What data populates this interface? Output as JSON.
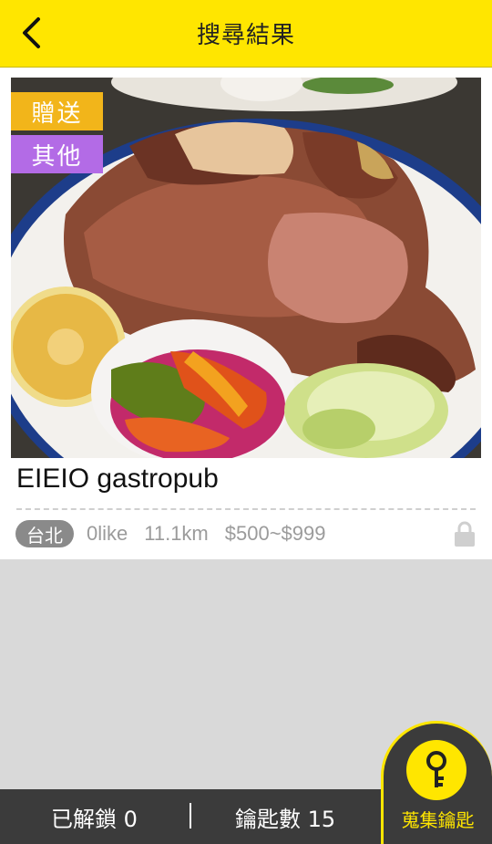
{
  "header": {
    "title": "搜尋結果",
    "back_icon": "chevron-left-icon"
  },
  "result": {
    "tags": [
      "贈送",
      "其他"
    ],
    "name": "EIEIO gastropub",
    "city": "台北",
    "likes": "0like",
    "distance": "11.1km",
    "price": "$500~$999",
    "lock_icon": "lock-icon"
  },
  "footer": {
    "unlocked": "已解鎖 0",
    "keys": "鑰匙數 15",
    "collect_label": "蒐集鑰匙",
    "collect_icon": "key-icon"
  },
  "colors": {
    "brand_yellow": "#ffe600",
    "tag_gift": "#f2b51a",
    "tag_other": "#b36be6",
    "bar_dark": "#3b3b3b"
  }
}
